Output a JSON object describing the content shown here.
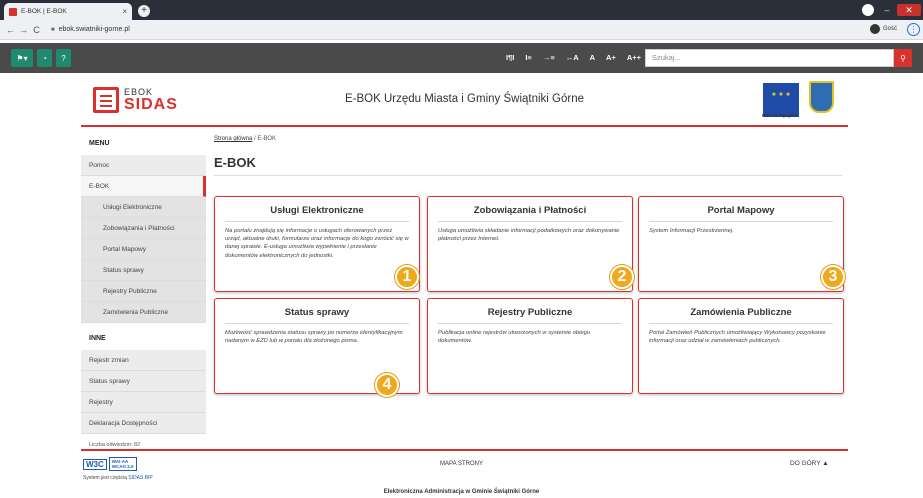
{
  "browser": {
    "tab_title": "E-BOK | E-BOK",
    "tab_close": "×",
    "new_tab": "+",
    "url": "ebok.swiatniki-gorne.pl",
    "profile_label": "Gość",
    "icons": [
      "back-icon",
      "forward-icon",
      "reload-icon",
      "lock-icon",
      "menu-icon"
    ]
  },
  "topbar": {
    "access": [
      "I¶I",
      "I≡",
      "→≡",
      "↔A",
      "A",
      "A+",
      "A++",
      "◉"
    ],
    "search_placeholder": "Szukaj...",
    "buttons": [
      "flag-icon",
      "rss-icon",
      "help-icon",
      "search-icon"
    ],
    "accent": "#1e8b6e"
  },
  "header": {
    "logo_top": "EBOK",
    "logo_bottom": "SIDAS",
    "title": "E-BOK Urzędu Miasta i Gminy Świątniki Górne",
    "eu_label": "Unia Europejska",
    "brand_color": "#d9322c"
  },
  "sidebar": {
    "menu_heading": "MENU",
    "menu": [
      {
        "label": "Pomoc"
      },
      {
        "label": "E-BOK",
        "active": true
      },
      {
        "label": "Usługi Elektroniczne",
        "sub": true
      },
      {
        "label": "Zobowiązania i Płatności",
        "sub": true
      },
      {
        "label": "Portal Mapowy",
        "sub": true
      },
      {
        "label": "Status sprawy",
        "sub": true
      },
      {
        "label": "Rejestry Publiczne",
        "sub": true
      },
      {
        "label": "Zamówienia Publiczne",
        "sub": true
      }
    ],
    "other_heading": "INNE",
    "other": [
      {
        "label": "Rejestr zmian"
      },
      {
        "label": "Status sprawy"
      },
      {
        "label": "Rejestry"
      },
      {
        "label": "Deklaracja Dostępności"
      }
    ],
    "visits": "Liczba odwiedzin: 82"
  },
  "main": {
    "breadcrumb_home": "Strona główna",
    "breadcrumb_sep": "/",
    "breadcrumb_current": "E-BOK",
    "title": "E-BOK",
    "tiles": [
      {
        "title": "Usługi Elektroniczne",
        "desc": "Na portalu znajdują się informacje o usługach oferowanych przez urząd, aktualne druki, formularze oraz informacje do kogo zwrócić się w danej sprawie. E-usługa umożliwia wypełnienie i przesłanie dokumentów elektronicznych do jednostki.",
        "badge": "1"
      },
      {
        "title": "Zobowiązania i Płatności",
        "desc": "Usługa umożliwia składanie informacji podatkowych oraz dokonywanie płatności przez Internet.",
        "badge": "2"
      },
      {
        "title": "Portal Mapowy",
        "desc": "System Informacji Przestrzennej.",
        "badge": "3"
      },
      {
        "title": "Status sprawy",
        "desc": "Możliwość sprawdzenia statusu sprawy po numerze identyfikacyjnym nadanym w EZD lub w portalu dla złożonego pisma.",
        "badge": "4"
      },
      {
        "title": "Rejestry Publiczne",
        "desc": "Publikacja online rejestrów utworzonych w systemie obiegu dokumentów.",
        "badge": ""
      },
      {
        "title": "Zamówienia Publiczne",
        "desc": "Portal Zamówień Publicznych umożliwiający Wykonawcy pozyskanie informacji oraz udział w zamówieniach publicznych.",
        "badge": ""
      }
    ],
    "badge_color": "#f0a81d"
  },
  "footer": {
    "wcag_mark": "W3C",
    "wcag_line1": "WAI-AA",
    "wcag_line2": "WCAG 2.0",
    "sidas_note": "System jest częścią",
    "sidas_link": "SIDAS BIP",
    "sitemap": "MAPA STRONY",
    "to_top": "DO GÓRY",
    "bottom_title": "Elektroniczna Administracja w Gminie Świątniki Górne"
  }
}
